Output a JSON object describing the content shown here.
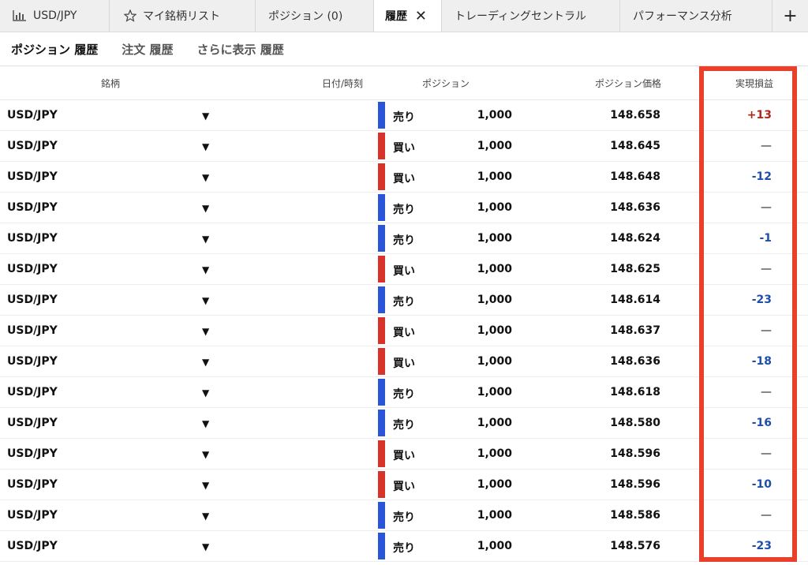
{
  "colors": {
    "buy": "#d8332a",
    "sell": "#2b55d9",
    "profit": "#b0261a",
    "loss": "#1d4fa8",
    "highlight": "#e8402a"
  },
  "tabs": [
    {
      "label": "USD/JPY",
      "icon": "chart-bars-icon"
    },
    {
      "label": "マイ銘柄リスト",
      "icon": "star-icon"
    },
    {
      "label": "ポジション (0)",
      "icon": ""
    },
    {
      "label": "履歴",
      "icon": "",
      "active": true
    },
    {
      "label": "トレーディングセントラル",
      "icon": ""
    },
    {
      "label": "パフォーマンス分析",
      "icon": ""
    }
  ],
  "tab_close": "✕",
  "tab_add": "+",
  "subtabs": [
    "ポジション 履歴",
    "注文 履歴",
    "さらに表示 履歴"
  ],
  "columns": {
    "symbol": "銘柄",
    "datetime": "日付/時刻",
    "position": "ポジション",
    "price": "ポジション価格",
    "pl": "実現損益"
  },
  "rows": [
    {
      "symbol": "USD/JPY",
      "side": "売り",
      "qty": "1,000",
      "price": "148.658",
      "pl": "+13"
    },
    {
      "symbol": "USD/JPY",
      "side": "買い",
      "qty": "1,000",
      "price": "148.645",
      "pl": "—"
    },
    {
      "symbol": "USD/JPY",
      "side": "買い",
      "qty": "1,000",
      "price": "148.648",
      "pl": "-12"
    },
    {
      "symbol": "USD/JPY",
      "side": "売り",
      "qty": "1,000",
      "price": "148.636",
      "pl": "—"
    },
    {
      "symbol": "USD/JPY",
      "side": "売り",
      "qty": "1,000",
      "price": "148.624",
      "pl": "-1"
    },
    {
      "symbol": "USD/JPY",
      "side": "買い",
      "qty": "1,000",
      "price": "148.625",
      "pl": "—"
    },
    {
      "symbol": "USD/JPY",
      "side": "売り",
      "qty": "1,000",
      "price": "148.614",
      "pl": "-23"
    },
    {
      "symbol": "USD/JPY",
      "side": "買い",
      "qty": "1,000",
      "price": "148.637",
      "pl": "—"
    },
    {
      "symbol": "USD/JPY",
      "side": "買い",
      "qty": "1,000",
      "price": "148.636",
      "pl": "-18"
    },
    {
      "symbol": "USD/JPY",
      "side": "売り",
      "qty": "1,000",
      "price": "148.618",
      "pl": "—"
    },
    {
      "symbol": "USD/JPY",
      "side": "売り",
      "qty": "1,000",
      "price": "148.580",
      "pl": "-16"
    },
    {
      "symbol": "USD/JPY",
      "side": "買い",
      "qty": "1,000",
      "price": "148.596",
      "pl": "—"
    },
    {
      "symbol": "USD/JPY",
      "side": "買い",
      "qty": "1,000",
      "price": "148.596",
      "pl": "-10"
    },
    {
      "symbol": "USD/JPY",
      "side": "売り",
      "qty": "1,000",
      "price": "148.586",
      "pl": "—"
    },
    {
      "symbol": "USD/JPY",
      "side": "売り",
      "qty": "1,000",
      "price": "148.576",
      "pl": "-23"
    }
  ]
}
